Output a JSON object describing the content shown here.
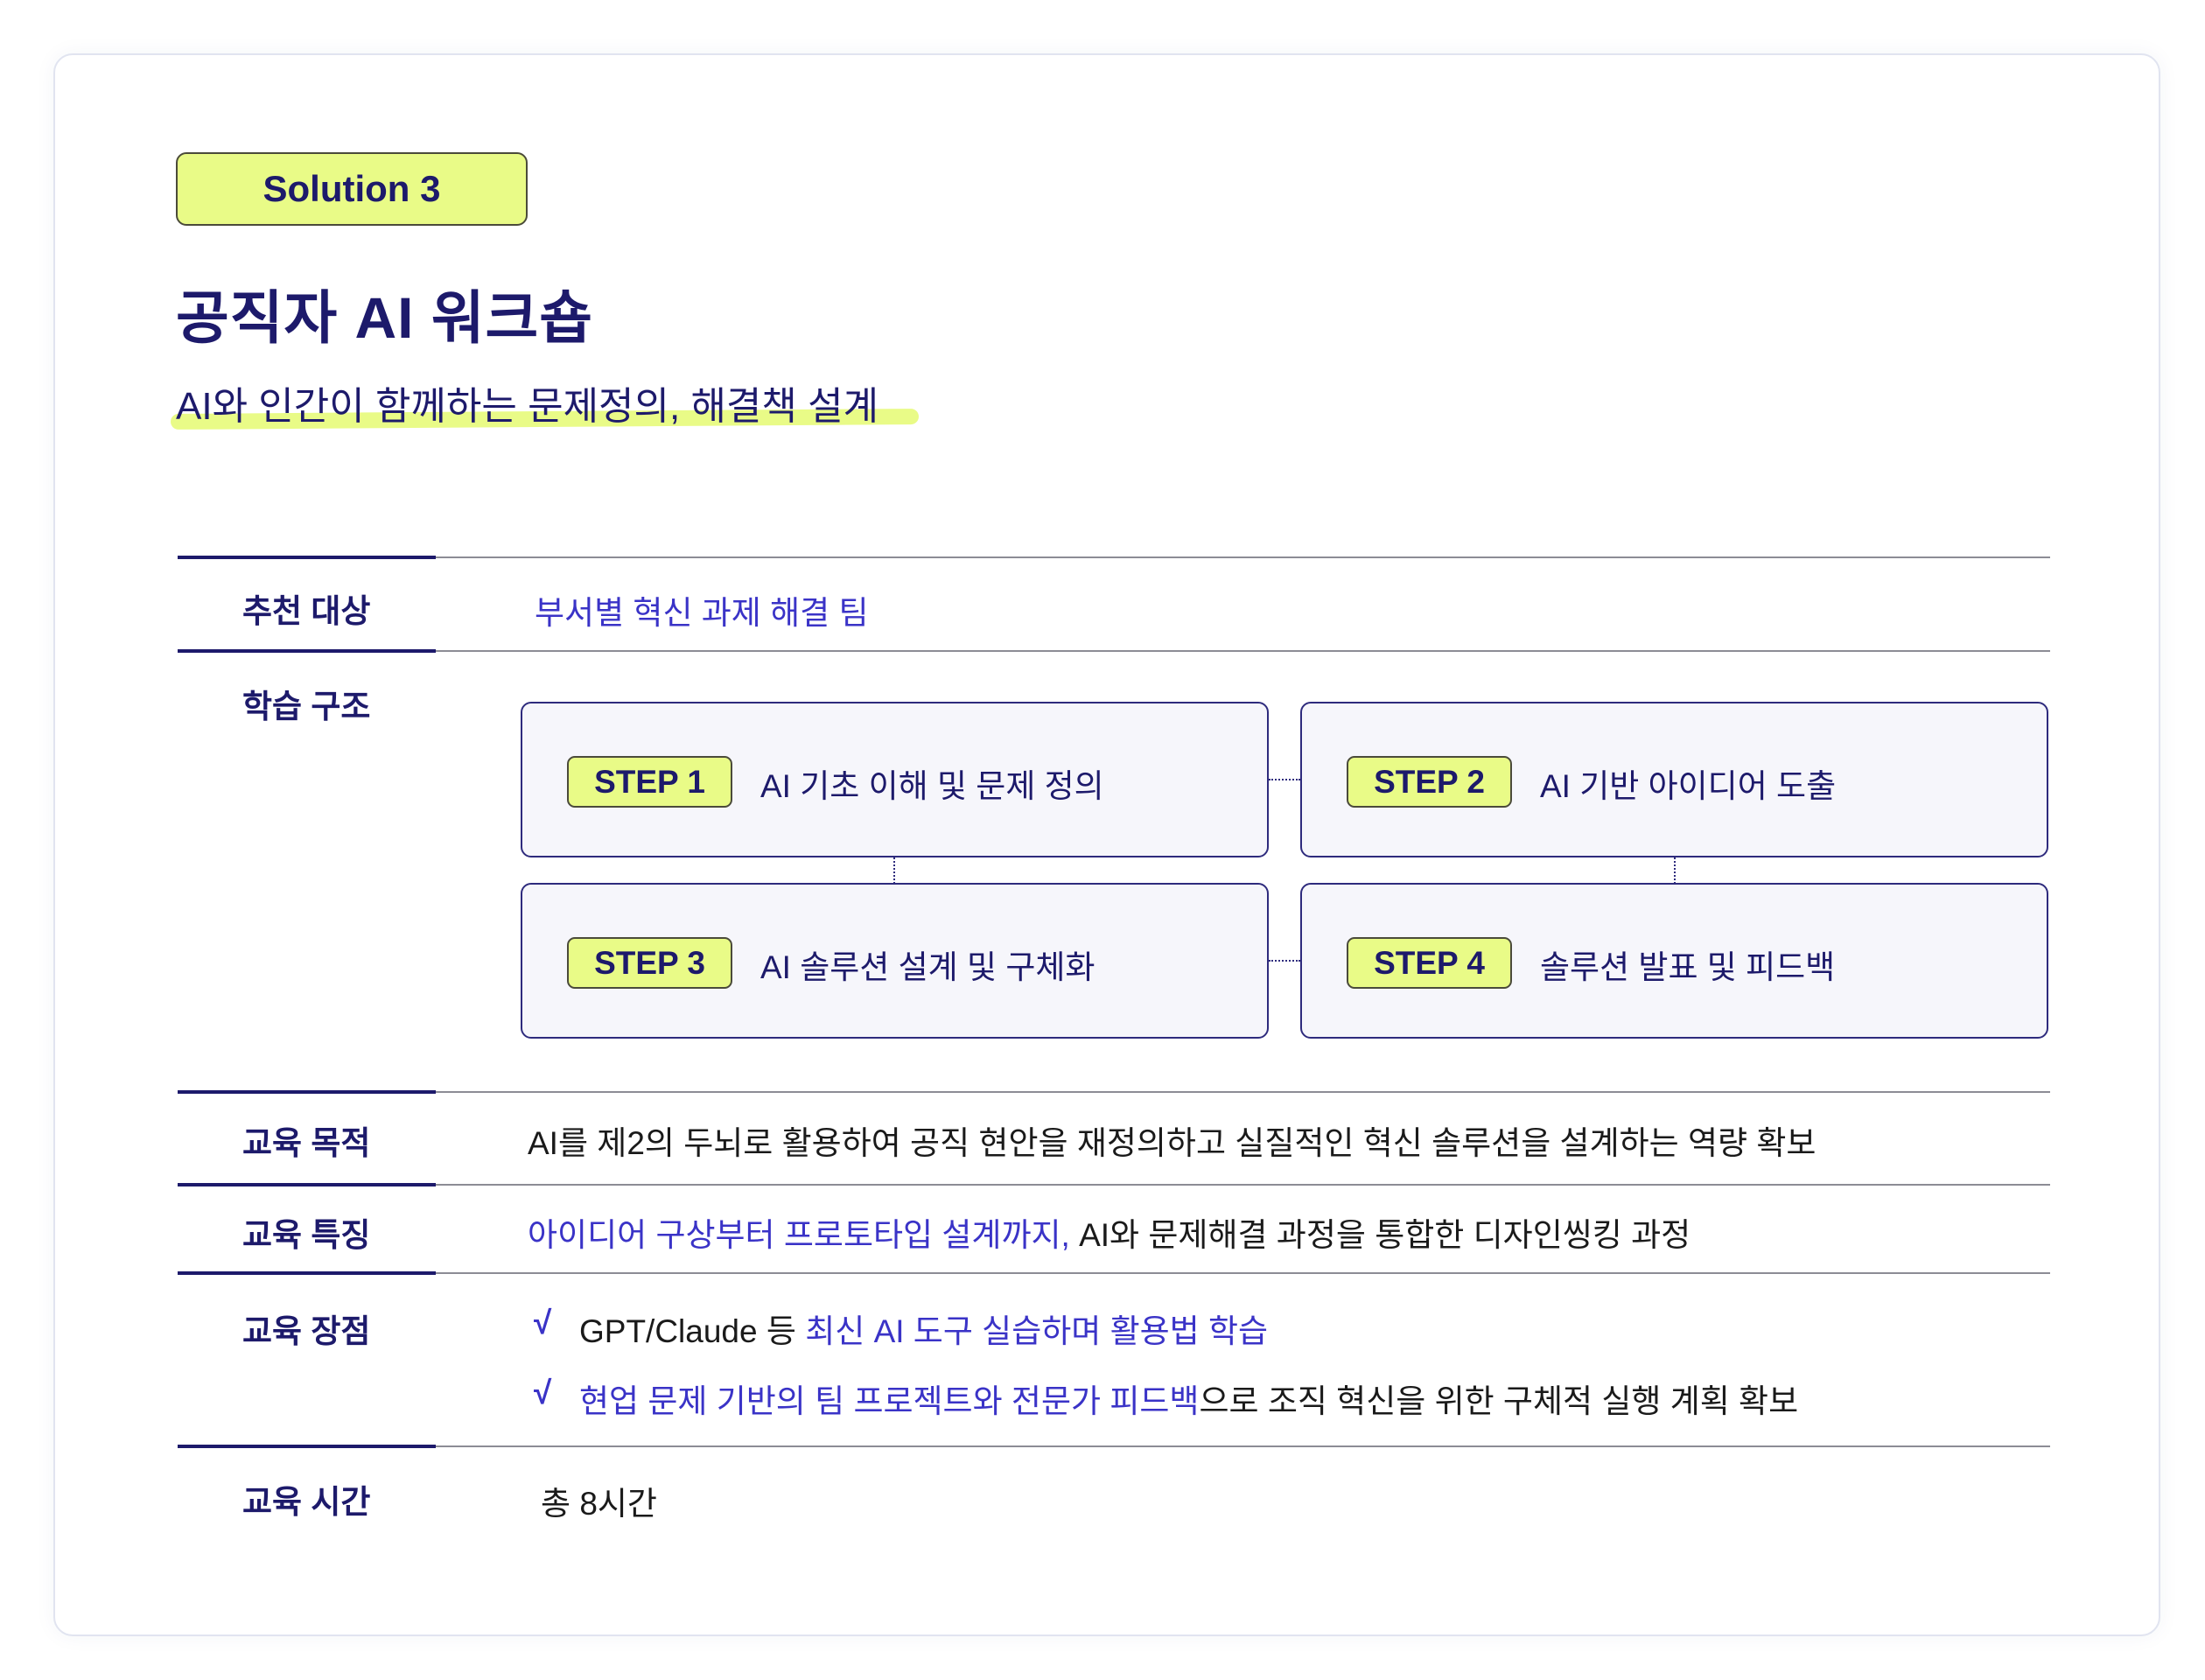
{
  "badge": "Solution 3",
  "title": "공직자 AI 워크숍",
  "subtitle": "AI와 인간이 함께하는 문제정의, 해결책 설계",
  "rows": {
    "target": {
      "label": "추천 대상",
      "value": "부서별 혁신 과제 해결 팀"
    },
    "structure": {
      "label": "학습 구조",
      "steps": [
        {
          "badge": "STEP 1",
          "text": "AI 기초 이해 및 문제 정의"
        },
        {
          "badge": "STEP 2",
          "text": "AI 기반 아이디어 도출"
        },
        {
          "badge": "STEP 3",
          "text": "AI 솔루션 설계 및 구체화"
        },
        {
          "badge": "STEP 4",
          "text": "솔루션 발표 및 피드백"
        }
      ]
    },
    "purpose": {
      "label": "교육 목적",
      "value": "AI를 제2의 두뇌로 활용하여 공직 현안을 재정의하고 실질적인 혁신 솔루션을 설계하는 역량 확보"
    },
    "feature": {
      "label": "교육 특징",
      "value_highlight": "아이디어 구상부터 프로토타입 설계까지,",
      "value_rest": " AI와 문제해결 과정을 통합한 디자인씽킹 과정"
    },
    "advantage": {
      "label": "교육 장점",
      "check": "√",
      "items": [
        {
          "part1": "GPT/Claude 등 ",
          "part2": "최신 AI 도구 실습하며 활용법 학습",
          "part3": ""
        },
        {
          "part1": "",
          "part2": "현업 문제 기반의 팀 프로젝트와 전문가 피드백",
          "part3": "으로 조직 혁신을 위한 구체적 실행 계획 확보"
        }
      ]
    },
    "time": {
      "label": "교육 시간",
      "value": "총 8시간"
    }
  },
  "colors": {
    "navy": "#1d1a6b",
    "accent_blue": "#3a33c7",
    "lime": "#e9fb87"
  }
}
